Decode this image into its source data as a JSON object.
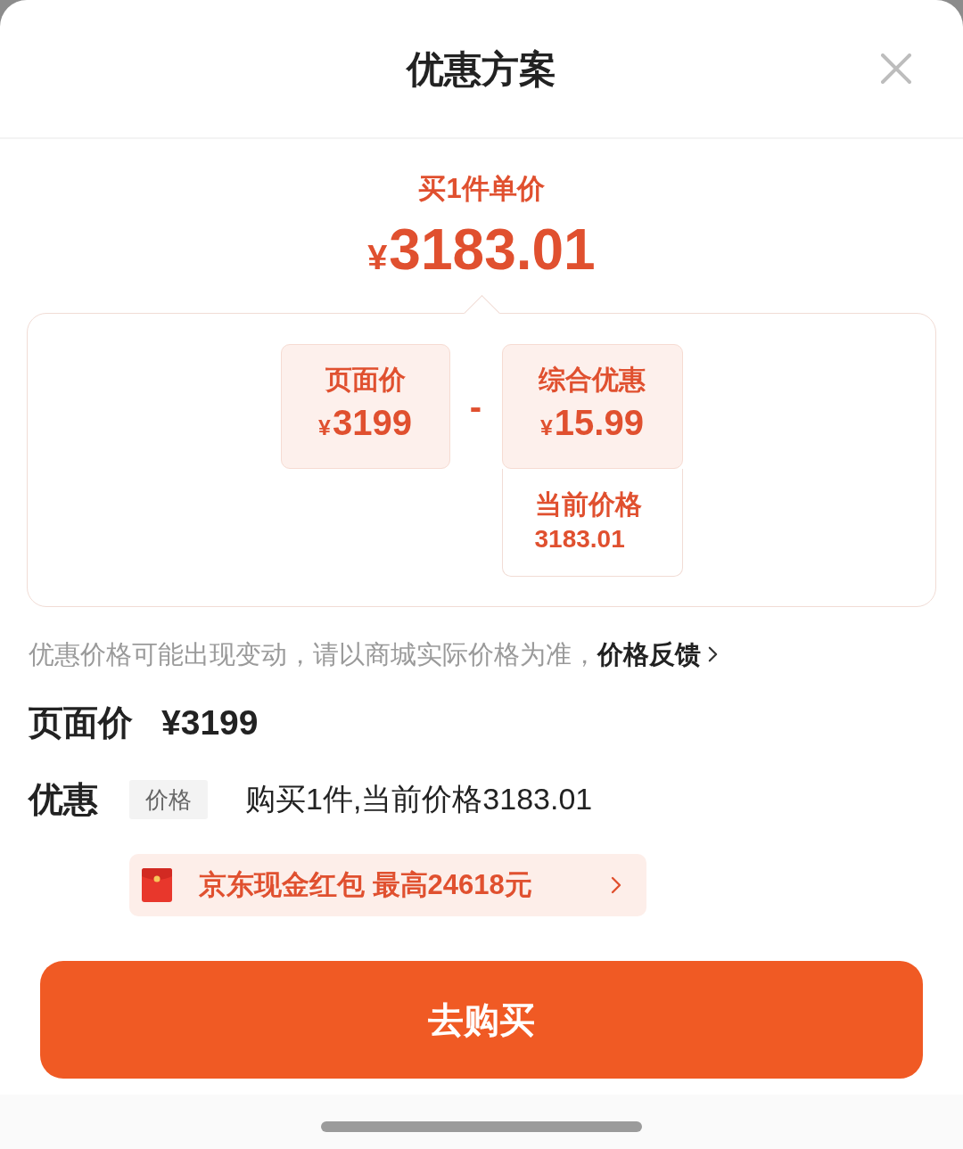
{
  "header": {
    "title": "优惠方案"
  },
  "summary": {
    "label": "买1件单价",
    "currency": "¥",
    "amount": "3183.01"
  },
  "breakdown": {
    "page_price": {
      "label": "页面价",
      "currency": "¥",
      "amount": "3199"
    },
    "operator": "-",
    "discount": {
      "label": "综合优惠",
      "currency": "¥",
      "amount": "15.99"
    },
    "current": {
      "label": "当前价格",
      "amount": "3183.01"
    }
  },
  "notice": {
    "text": "优惠价格可能出现变动，请以商城实际价格为准，",
    "link": "价格反馈"
  },
  "page_price_row": {
    "label": "页面价",
    "value": "¥3199"
  },
  "discount_row": {
    "label": "优惠",
    "tag": "价格",
    "text": "购买1件,当前价格3183.01"
  },
  "red_packet": {
    "text": "京东现金红包 最高24618元"
  },
  "buy_button": {
    "label": "去购买"
  }
}
